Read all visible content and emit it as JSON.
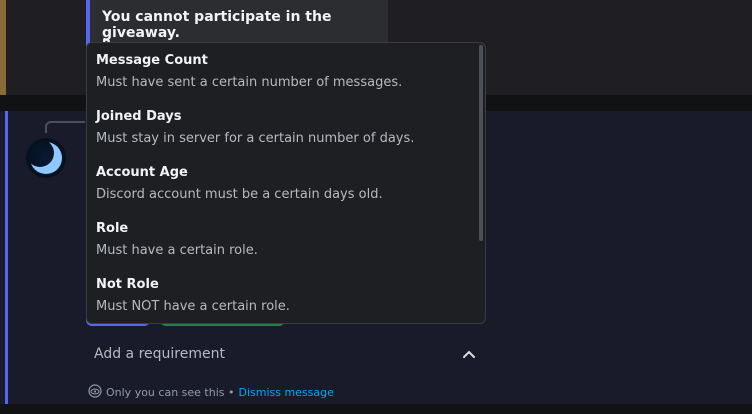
{
  "previous_message": {
    "embed_title": "You cannot participate in the giveaway.",
    "embed_cut_text": "R"
  },
  "dropdown": {
    "options": [
      {
        "label": "Message Count",
        "description": "Must have sent a certain number of messages."
      },
      {
        "label": "Joined Days",
        "description": "Must stay in server for a certain number of days."
      },
      {
        "label": "Account Age",
        "description": "Discord account must be a certain days old."
      },
      {
        "label": "Role",
        "description": "Must have a certain role."
      },
      {
        "label": "Not Role",
        "description": "Must NOT have a certain role."
      }
    ]
  },
  "select": {
    "placeholder": "Add a requirement",
    "icon": "chevron-up-icon"
  },
  "ephemeral": {
    "notice": "Only you can see this •",
    "dismiss_label": "Dismiss message",
    "icon": "eye-icon"
  },
  "colors": {
    "accent": "#5865f2",
    "link": "#00a8fc",
    "success": "#248046"
  }
}
